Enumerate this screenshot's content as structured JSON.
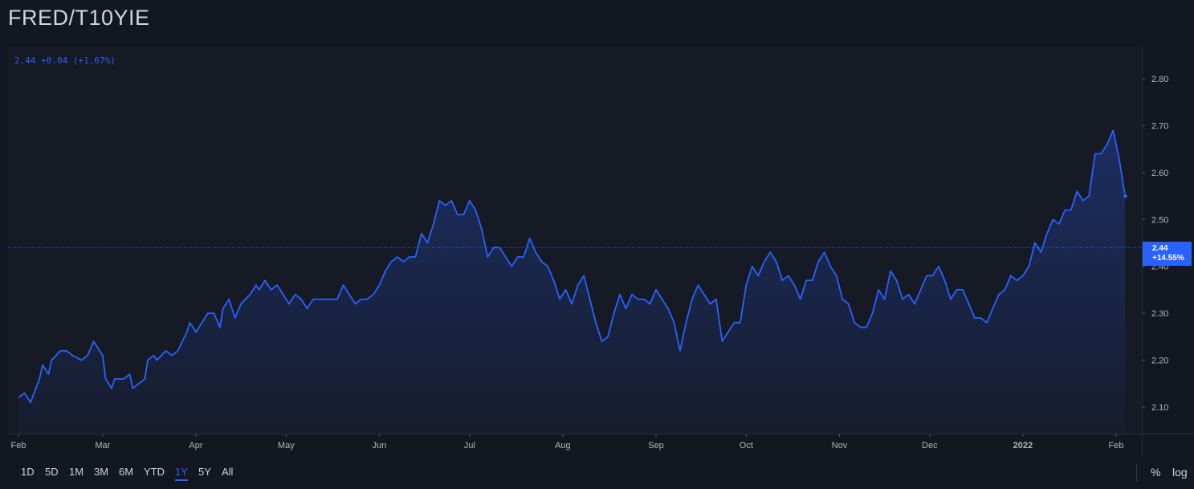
{
  "title": "FRED/T10YIE",
  "legend": {
    "value": "2.44",
    "change": "+0.04",
    "change_pct": "(+1.67%)"
  },
  "last_price": {
    "value": "2.44",
    "change_pct": "+14.55%"
  },
  "range_buttons": [
    "1D",
    "5D",
    "1M",
    "3M",
    "6M",
    "YTD",
    "1Y",
    "5Y",
    "All"
  ],
  "active_range": "1Y",
  "scale_options": {
    "percent": "%",
    "log": "log"
  },
  "colors": {
    "background": "#131722",
    "pane": "#161a25",
    "line": "#2962ff",
    "text": "#b2b5be",
    "grid": "#232632"
  },
  "chart_data": {
    "type": "area",
    "title": "FRED/T10YIE",
    "ylim": [
      2.06,
      2.87
    ],
    "yticks": [
      2.1,
      2.2,
      2.3,
      2.4,
      2.5,
      2.6,
      2.7,
      2.8
    ],
    "ytick_labels": [
      "2.10",
      "2.20",
      "2.30",
      "2.40",
      "2.50",
      "2.60",
      "2.70",
      "2.80"
    ],
    "xticks": [
      {
        "label": "Feb",
        "date": "2021-02-01"
      },
      {
        "label": "Mar",
        "date": "2021-03-01"
      },
      {
        "label": "Apr",
        "date": "2021-04-01"
      },
      {
        "label": "May",
        "date": "2021-05-01"
      },
      {
        "label": "Jun",
        "date": "2021-06-01"
      },
      {
        "label": "Jul",
        "date": "2021-07-01"
      },
      {
        "label": "Aug",
        "date": "2021-08-01"
      },
      {
        "label": "Sep",
        "date": "2021-09-01"
      },
      {
        "label": "Oct",
        "date": "2021-10-01"
      },
      {
        "label": "Nov",
        "date": "2021-11-01"
      },
      {
        "label": "Dec",
        "date": "2021-12-01"
      },
      {
        "label": "2022",
        "date": "2022-01-01",
        "bold": true
      },
      {
        "label": "Feb",
        "date": "2022-02-01"
      }
    ],
    "x_range": [
      "2021-02-01",
      "2022-02-05"
    ],
    "series": [
      {
        "points": [
          [
            "2021-02-01",
            2.12
          ],
          [
            "2021-02-03",
            2.13
          ],
          [
            "2021-02-05",
            2.11
          ],
          [
            "2021-02-08",
            2.16
          ],
          [
            "2021-02-09",
            2.19
          ],
          [
            "2021-02-11",
            2.17
          ],
          [
            "2021-02-12",
            2.2
          ],
          [
            "2021-02-15",
            2.22
          ],
          [
            "2021-02-17",
            2.22
          ],
          [
            "2021-02-19",
            2.21
          ],
          [
            "2021-02-22",
            2.2
          ],
          [
            "2021-02-24",
            2.21
          ],
          [
            "2021-02-26",
            2.24
          ],
          [
            "2021-03-01",
            2.21
          ],
          [
            "2021-03-02",
            2.16
          ],
          [
            "2021-03-04",
            2.14
          ],
          [
            "2021-03-05",
            2.16
          ],
          [
            "2021-03-08",
            2.16
          ],
          [
            "2021-03-10",
            2.17
          ],
          [
            "2021-03-11",
            2.14
          ],
          [
            "2021-03-15",
            2.16
          ],
          [
            "2021-03-16",
            2.2
          ],
          [
            "2021-03-18",
            2.21
          ],
          [
            "2021-03-19",
            2.2
          ],
          [
            "2021-03-22",
            2.22
          ],
          [
            "2021-03-24",
            2.21
          ],
          [
            "2021-03-26",
            2.22
          ],
          [
            "2021-03-29",
            2.26
          ],
          [
            "2021-03-30",
            2.28
          ],
          [
            "2021-04-01",
            2.26
          ],
          [
            "2021-04-02",
            2.27
          ],
          [
            "2021-04-05",
            2.3
          ],
          [
            "2021-04-07",
            2.3
          ],
          [
            "2021-04-09",
            2.27
          ],
          [
            "2021-04-10",
            2.31
          ],
          [
            "2021-04-12",
            2.33
          ],
          [
            "2021-04-14",
            2.29
          ],
          [
            "2021-04-16",
            2.32
          ],
          [
            "2021-04-19",
            2.34
          ],
          [
            "2021-04-21",
            2.36
          ],
          [
            "2021-04-22",
            2.35
          ],
          [
            "2021-04-24",
            2.37
          ],
          [
            "2021-04-26",
            2.35
          ],
          [
            "2021-04-28",
            2.36
          ],
          [
            "2021-04-30",
            2.34
          ],
          [
            "2021-05-02",
            2.32
          ],
          [
            "2021-05-04",
            2.34
          ],
          [
            "2021-05-06",
            2.33
          ],
          [
            "2021-05-08",
            2.31
          ],
          [
            "2021-05-10",
            2.33
          ],
          [
            "2021-05-14",
            2.33
          ],
          [
            "2021-05-18",
            2.33
          ],
          [
            "2021-05-20",
            2.36
          ],
          [
            "2021-05-22",
            2.34
          ],
          [
            "2021-05-24",
            2.32
          ],
          [
            "2021-05-26",
            2.33
          ],
          [
            "2021-05-28",
            2.33
          ],
          [
            "2021-05-30",
            2.34
          ],
          [
            "2021-06-01",
            2.36
          ],
          [
            "2021-06-03",
            2.39
          ],
          [
            "2021-06-05",
            2.41
          ],
          [
            "2021-06-07",
            2.42
          ],
          [
            "2021-06-09",
            2.41
          ],
          [
            "2021-06-11",
            2.42
          ],
          [
            "2021-06-13",
            2.42
          ],
          [
            "2021-06-15",
            2.47
          ],
          [
            "2021-06-17",
            2.45
          ],
          [
            "2021-06-19",
            2.49
          ],
          [
            "2021-06-21",
            2.54
          ],
          [
            "2021-06-23",
            2.53
          ],
          [
            "2021-06-25",
            2.54
          ],
          [
            "2021-06-27",
            2.51
          ],
          [
            "2021-06-29",
            2.51
          ],
          [
            "2021-07-01",
            2.54
          ],
          [
            "2021-07-03",
            2.52
          ],
          [
            "2021-07-05",
            2.48
          ],
          [
            "2021-07-07",
            2.42
          ],
          [
            "2021-07-09",
            2.44
          ],
          [
            "2021-07-11",
            2.44
          ],
          [
            "2021-07-13",
            2.42
          ],
          [
            "2021-07-15",
            2.4
          ],
          [
            "2021-07-17",
            2.42
          ],
          [
            "2021-07-19",
            2.42
          ],
          [
            "2021-07-21",
            2.46
          ],
          [
            "2021-07-23",
            2.43
          ],
          [
            "2021-07-25",
            2.41
          ],
          [
            "2021-07-27",
            2.4
          ],
          [
            "2021-07-29",
            2.37
          ],
          [
            "2021-07-31",
            2.33
          ],
          [
            "2021-08-02",
            2.35
          ],
          [
            "2021-08-04",
            2.32
          ],
          [
            "2021-08-06",
            2.36
          ],
          [
            "2021-08-08",
            2.38
          ],
          [
            "2021-08-10",
            2.33
          ],
          [
            "2021-08-12",
            2.28
          ],
          [
            "2021-08-14",
            2.24
          ],
          [
            "2021-08-16",
            2.25
          ],
          [
            "2021-08-18",
            2.3
          ],
          [
            "2021-08-20",
            2.34
          ],
          [
            "2021-08-22",
            2.31
          ],
          [
            "2021-08-24",
            2.34
          ],
          [
            "2021-08-26",
            2.33
          ],
          [
            "2021-08-28",
            2.33
          ],
          [
            "2021-08-30",
            2.32
          ],
          [
            "2021-09-01",
            2.35
          ],
          [
            "2021-09-03",
            2.33
          ],
          [
            "2021-09-05",
            2.31
          ],
          [
            "2021-09-07",
            2.28
          ],
          [
            "2021-09-09",
            2.22
          ],
          [
            "2021-09-11",
            2.28
          ],
          [
            "2021-09-13",
            2.33
          ],
          [
            "2021-09-15",
            2.36
          ],
          [
            "2021-09-17",
            2.34
          ],
          [
            "2021-09-19",
            2.32
          ],
          [
            "2021-09-21",
            2.33
          ],
          [
            "2021-09-23",
            2.24
          ],
          [
            "2021-09-25",
            2.26
          ],
          [
            "2021-09-27",
            2.28
          ],
          [
            "2021-09-29",
            2.28
          ],
          [
            "2021-10-01",
            2.36
          ],
          [
            "2021-10-03",
            2.4
          ],
          [
            "2021-10-05",
            2.38
          ],
          [
            "2021-10-07",
            2.41
          ],
          [
            "2021-10-09",
            2.43
          ],
          [
            "2021-10-11",
            2.41
          ],
          [
            "2021-10-13",
            2.37
          ],
          [
            "2021-10-15",
            2.38
          ],
          [
            "2021-10-17",
            2.36
          ],
          [
            "2021-10-19",
            2.33
          ],
          [
            "2021-10-21",
            2.37
          ],
          [
            "2021-10-23",
            2.37
          ],
          [
            "2021-10-25",
            2.41
          ],
          [
            "2021-10-27",
            2.43
          ],
          [
            "2021-10-29",
            2.4
          ],
          [
            "2021-10-31",
            2.38
          ],
          [
            "2021-11-02",
            2.33
          ],
          [
            "2021-11-04",
            2.32
          ],
          [
            "2021-11-06",
            2.28
          ],
          [
            "2021-11-08",
            2.27
          ],
          [
            "2021-11-10",
            2.27
          ],
          [
            "2021-11-12",
            2.3
          ],
          [
            "2021-11-14",
            2.35
          ],
          [
            "2021-11-16",
            2.33
          ],
          [
            "2021-11-18",
            2.39
          ],
          [
            "2021-11-20",
            2.37
          ],
          [
            "2021-11-22",
            2.33
          ],
          [
            "2021-11-24",
            2.34
          ],
          [
            "2021-11-26",
            2.32
          ],
          [
            "2021-11-28",
            2.35
          ],
          [
            "2021-11-30",
            2.38
          ],
          [
            "2021-12-02",
            2.38
          ],
          [
            "2021-12-04",
            2.4
          ],
          [
            "2021-12-06",
            2.37
          ],
          [
            "2021-12-08",
            2.33
          ],
          [
            "2021-12-10",
            2.35
          ],
          [
            "2021-12-12",
            2.35
          ],
          [
            "2021-12-14",
            2.32
          ],
          [
            "2021-12-16",
            2.29
          ],
          [
            "2021-12-18",
            2.29
          ],
          [
            "2021-12-20",
            2.28
          ],
          [
            "2021-12-22",
            2.31
          ],
          [
            "2021-12-24",
            2.34
          ],
          [
            "2021-12-26",
            2.35
          ],
          [
            "2021-12-28",
            2.38
          ],
          [
            "2021-12-30",
            2.37
          ],
          [
            "2022-01-01",
            2.38
          ],
          [
            "2022-01-03",
            2.4
          ],
          [
            "2022-01-05",
            2.45
          ],
          [
            "2022-01-07",
            2.43
          ],
          [
            "2022-01-09",
            2.47
          ],
          [
            "2022-01-11",
            2.5
          ],
          [
            "2022-01-13",
            2.49
          ],
          [
            "2022-01-15",
            2.52
          ],
          [
            "2022-01-17",
            2.52
          ],
          [
            "2022-01-19",
            2.56
          ],
          [
            "2022-01-21",
            2.54
          ],
          [
            "2022-01-23",
            2.55
          ],
          [
            "2022-01-25",
            2.64
          ],
          [
            "2022-01-27",
            2.64
          ],
          [
            "2022-01-29",
            2.66
          ],
          [
            "2022-01-31",
            2.69
          ],
          [
            "2022-02-02",
            2.63
          ],
          [
            "2022-02-04",
            2.55
          ]
        ]
      }
    ]
  }
}
